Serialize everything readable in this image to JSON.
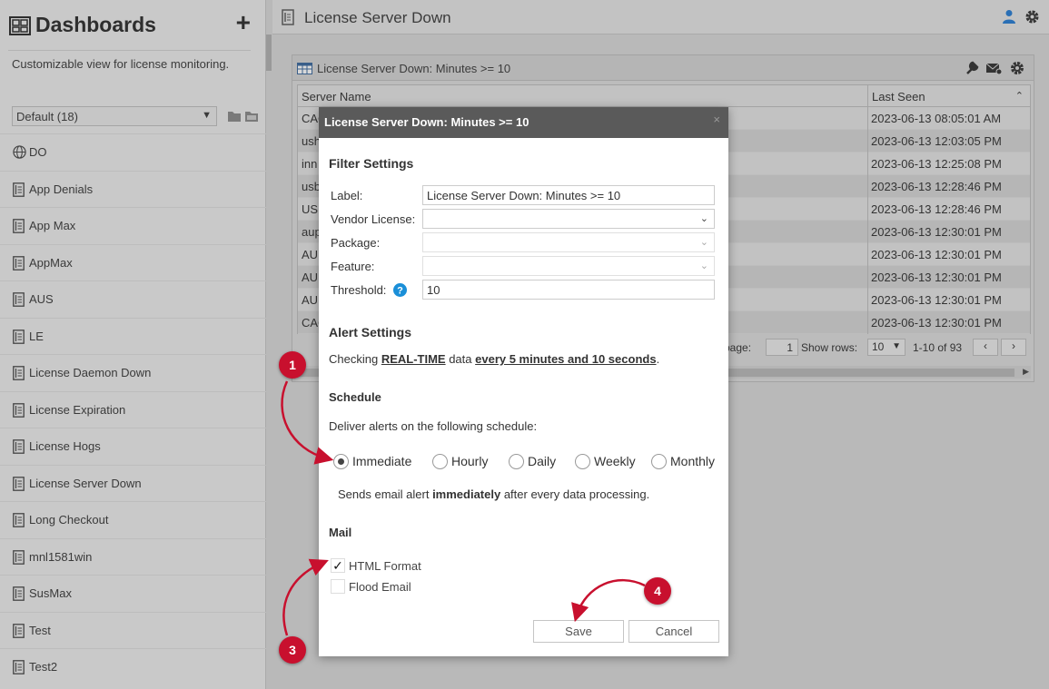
{
  "sidebar": {
    "title": "Dashboards",
    "add_label": "+",
    "description": "Customizable view for license monitoring.",
    "select_value": "Default (18)",
    "items": [
      {
        "label": "DO",
        "icon": "globe-icon"
      },
      {
        "label": "App Denials",
        "icon": "dashboard-doc-icon"
      },
      {
        "label": "App Max",
        "icon": "dashboard-doc-icon"
      },
      {
        "label": "AppMax",
        "icon": "dashboard-doc-icon"
      },
      {
        "label": "AUS",
        "icon": "dashboard-doc-icon"
      },
      {
        "label": "LE",
        "icon": "dashboard-doc-icon"
      },
      {
        "label": "License Daemon Down",
        "icon": "dashboard-doc-icon"
      },
      {
        "label": "License Expiration",
        "icon": "dashboard-doc-icon"
      },
      {
        "label": "License Hogs",
        "icon": "dashboard-doc-icon"
      },
      {
        "label": "License Server Down",
        "icon": "dashboard-doc-icon"
      },
      {
        "label": "Long Checkout",
        "icon": "dashboard-doc-icon"
      },
      {
        "label": "mnl1581win",
        "icon": "dashboard-doc-icon"
      },
      {
        "label": "SusMax",
        "icon": "dashboard-doc-icon"
      },
      {
        "label": "Test",
        "icon": "dashboard-doc-icon"
      },
      {
        "label": "Test2",
        "icon": "dashboard-doc-icon"
      }
    ]
  },
  "topbar": {
    "title": "License Server Down"
  },
  "panel": {
    "title": "License Server Down: Minutes >= 10",
    "columns": [
      "Server Name",
      "Last Seen"
    ],
    "rows": [
      {
        "server": "CAC",
        "last_seen": "2023-06-13 08:05:01 AM"
      },
      {
        "server": "ush",
        "last_seen": "2023-06-13 12:03:05 PM"
      },
      {
        "server": "inn",
        "last_seen": "2023-06-13 12:25:08 PM"
      },
      {
        "server": "usb",
        "last_seen": "2023-06-13 12:28:46 PM"
      },
      {
        "server": "USE",
        "last_seen": "2023-06-13 12:28:46 PM"
      },
      {
        "server": "aup",
        "last_seen": "2023-06-13 12:30:01 PM"
      },
      {
        "server": "AUI",
        "last_seen": "2023-06-13 12:30:01 PM"
      },
      {
        "server": "AUI",
        "last_seen": "2023-06-13 12:30:01 PM"
      },
      {
        "server": "AUI",
        "last_seen": "2023-06-13 12:30:01 PM"
      },
      {
        "server": "CAC",
        "last_seen": "2023-06-13 12:30:01 PM"
      }
    ],
    "pager": {
      "page_label": "page:",
      "page_value": "1",
      "rows_label": "Show rows:",
      "rows_value": "10",
      "range": "1-10 of 93",
      "prev": "‹",
      "next": "›"
    }
  },
  "modal": {
    "title": "License Server Down: Minutes >= 10",
    "close": "×",
    "filter_title": "Filter Settings",
    "fields": {
      "label_lbl": "Label:",
      "label_val": "License Server Down: Minutes >= 10",
      "vendor_lbl": "Vendor License:",
      "vendor_val": "",
      "package_lbl": "Package:",
      "package_val": "",
      "feature_lbl": "Feature:",
      "feature_val": "",
      "threshold_lbl": "Threshold:",
      "threshold_val": "10"
    },
    "alert_title": "Alert Settings",
    "alert_text_1": "Checking ",
    "alert_realtime": "REAL-TIME",
    "alert_text_2": " data ",
    "alert_interval": "every 5 minutes and 10 seconds",
    "alert_text_3": ".",
    "schedule_title": "Schedule",
    "schedule_desc": "Deliver alerts on the following schedule:",
    "schedule_options": [
      "Immediate",
      "Hourly",
      "Daily",
      "Weekly",
      "Monthly"
    ],
    "schedule_selected": "Immediate",
    "schedule_note_1": "Sends email alert ",
    "schedule_note_bold": "immediately",
    "schedule_note_2": " after every data processing.",
    "mail_title": "Mail",
    "html_format_label": "HTML Format",
    "html_format_checked": true,
    "flood_email_label": "Flood Email",
    "flood_email_checked": false,
    "save_label": "Save",
    "cancel_label": "Cancel"
  },
  "annotations": [
    "1",
    "3",
    "4"
  ],
  "colors": {
    "badge": "#c8102e",
    "modal_header": "#5a5a5a",
    "help_icon": "#1a8fd8",
    "user_icon": "#2a6fb5"
  }
}
